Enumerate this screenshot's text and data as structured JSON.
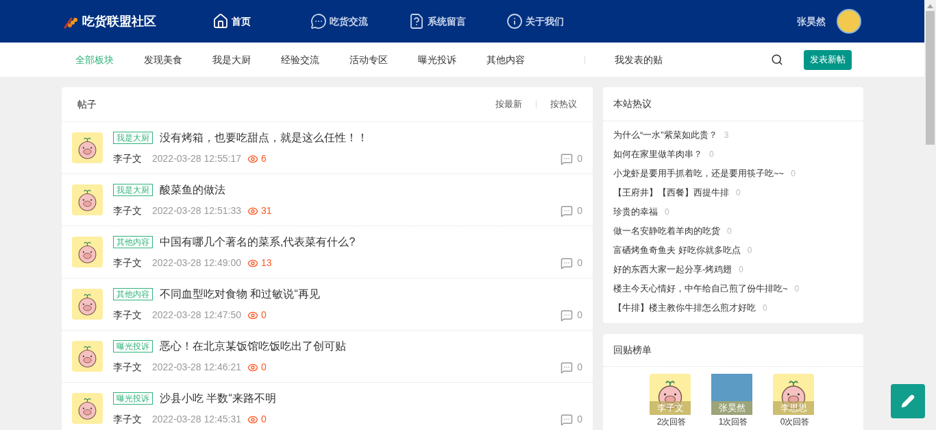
{
  "header": {
    "logo": "吃货联盟社区",
    "nav": [
      {
        "label": "首页",
        "kind": "home",
        "selected": true
      },
      {
        "label": "吃货交流",
        "kind": "chat",
        "selected": false
      },
      {
        "label": "系统留言",
        "kind": "message",
        "selected": false
      },
      {
        "label": "关于我们",
        "kind": "about",
        "selected": false
      }
    ],
    "user": {
      "name": "张昊然"
    }
  },
  "subnav": {
    "items": [
      {
        "label": "全部板块",
        "selected": true
      },
      {
        "label": "发现美食",
        "selected": false
      },
      {
        "label": "我是大厨",
        "selected": false
      },
      {
        "label": "经验交流",
        "selected": false
      },
      {
        "label": "活动专区",
        "selected": false
      },
      {
        "label": "曝光投诉",
        "selected": false
      },
      {
        "label": "其他内容",
        "selected": false
      }
    ],
    "my_posts": "我发表的贴",
    "new_post_button": "发表新帖"
  },
  "posts": {
    "title": "帖子",
    "sort": [
      {
        "label": "按最新",
        "selected": false
      },
      {
        "label": "按热议",
        "selected": false
      }
    ],
    "items": [
      {
        "tag": "我是大厨",
        "title": "没有烤箱，也要吃甜点，就是这么任性！！",
        "author": "李子文",
        "time": "2022-03-28 12:55:17",
        "views": "6",
        "comments": "0"
      },
      {
        "tag": "我是大厨",
        "title": "酸菜鱼的做法",
        "author": "李子文",
        "time": "2022-03-28 12:51:33",
        "views": "31",
        "comments": "0"
      },
      {
        "tag": "其他内容",
        "title": "中国有哪几个著名的菜系,代表菜有什么?",
        "author": "李子文",
        "time": "2022-03-28 12:49:00",
        "views": "13",
        "comments": "0"
      },
      {
        "tag": "其他内容",
        "title": "不同血型吃对食物 和过敏说“再见",
        "author": "李子文",
        "time": "2022-03-28 12:47:50",
        "views": "0",
        "comments": "0"
      },
      {
        "tag": "曝光投诉",
        "title": "恶心！在北京某饭馆吃饭吃出了创可贴",
        "author": "李子文",
        "time": "2022-03-28 12:46:21",
        "views": "0",
        "comments": "0"
      },
      {
        "tag": "曝光投诉",
        "title": "沙县小吃 半数“来路不明",
        "author": "李子文",
        "time": "2022-03-28 12:45:31",
        "views": "0",
        "comments": "0"
      }
    ]
  },
  "hot": {
    "title": "本站热议",
    "items": [
      {
        "title": "为什么“一水”紫菜如此贵？",
        "count": "3"
      },
      {
        "title": "如何在家里做羊肉串？",
        "count": "0"
      },
      {
        "title": "小龙虾是要用手抓着吃，还是要用筷子吃~~",
        "count": "0"
      },
      {
        "title": "【王府井】【西餐】西提牛排",
        "count": "0"
      },
      {
        "title": "珍贵的幸福",
        "count": "0"
      },
      {
        "title": "做一名安静吃着羊肉的吃货",
        "count": "0"
      },
      {
        "title": "富硒烤鱼奇鱼夫 好吃你就多吃点",
        "count": "0"
      },
      {
        "title": "好的东西大家一起分享-烤鸡翅",
        "count": "0"
      },
      {
        "title": "楼主今天心情好，中午给自己煎了份牛排吃~",
        "count": "0"
      },
      {
        "title": "【牛排】楼主教你牛排怎么煎才好吃",
        "count": "0"
      }
    ]
  },
  "ranking": {
    "title": "回贴榜单",
    "users": [
      {
        "name": "李子文",
        "replies": "2次回答",
        "kind": "pig"
      },
      {
        "name": "张昊然",
        "replies": "1次回答",
        "kind": "cartoon"
      },
      {
        "name": "李思思",
        "replies": "0次回答",
        "kind": "pig"
      }
    ]
  }
}
